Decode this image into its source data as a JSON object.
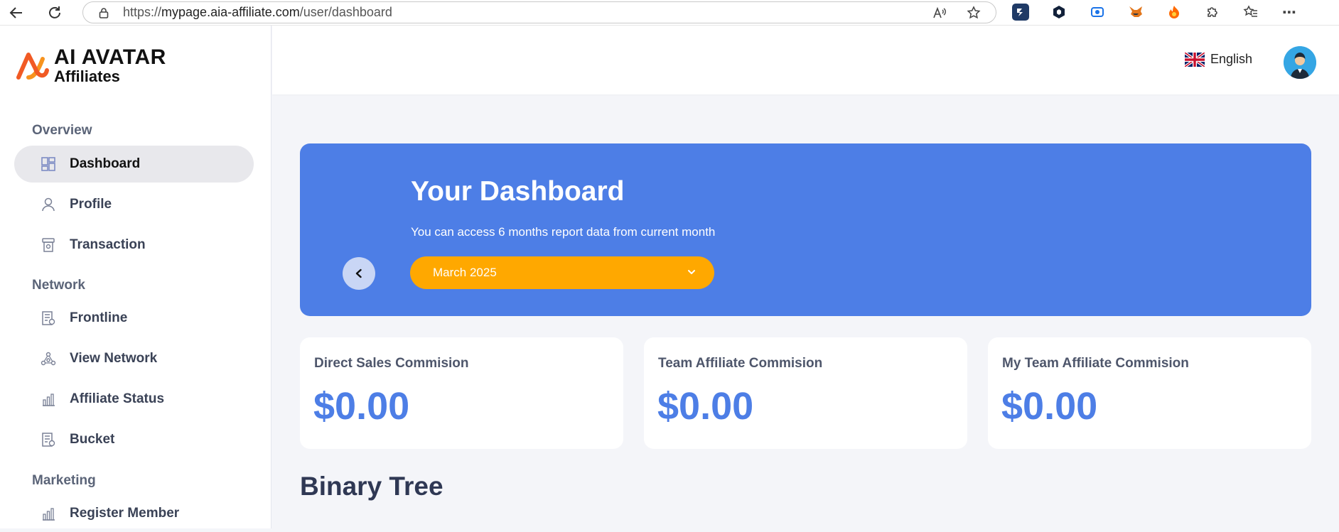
{
  "browser": {
    "url_prefix": "https://",
    "url_domain": "mypage.aia-affiliate.com",
    "url_path": "/user/dashboard"
  },
  "brand": {
    "title": "AI AVATAR",
    "subtitle": "Affiliates"
  },
  "sidebar": {
    "sections": [
      {
        "title": "Overview"
      },
      {
        "title": "Network"
      },
      {
        "title": "Marketing"
      }
    ],
    "items": [
      {
        "label": "Dashboard",
        "icon": "dashboard-icon",
        "active": true
      },
      {
        "label": "Profile",
        "icon": "user-icon"
      },
      {
        "label": "Transaction",
        "icon": "receipt-icon"
      },
      {
        "label": "Frontline",
        "icon": "list-icon"
      },
      {
        "label": "View Network",
        "icon": "network-icon"
      },
      {
        "label": "Affiliate Status",
        "icon": "bar-chart-icon"
      },
      {
        "label": "Bucket",
        "icon": "list-icon"
      },
      {
        "label": "Register Member",
        "icon": "bar-chart-icon"
      }
    ]
  },
  "topbar": {
    "language": "English"
  },
  "banner": {
    "title": "Your Dashboard",
    "subtitle": "You can access 6 months report data from current month",
    "selected_month": "March 2025"
  },
  "cards": [
    {
      "title": "Direct Sales Commision",
      "value": "$0.00"
    },
    {
      "title": "Team Affiliate Commision",
      "value": "$0.00"
    },
    {
      "title": "My Team Affiliate Commision",
      "value": "$0.00"
    }
  ],
  "sections": {
    "binary_tree": "Binary Tree"
  },
  "colors": {
    "accent": "#4d7ee6",
    "select": "#ffa800",
    "logo": "#f15a24"
  }
}
